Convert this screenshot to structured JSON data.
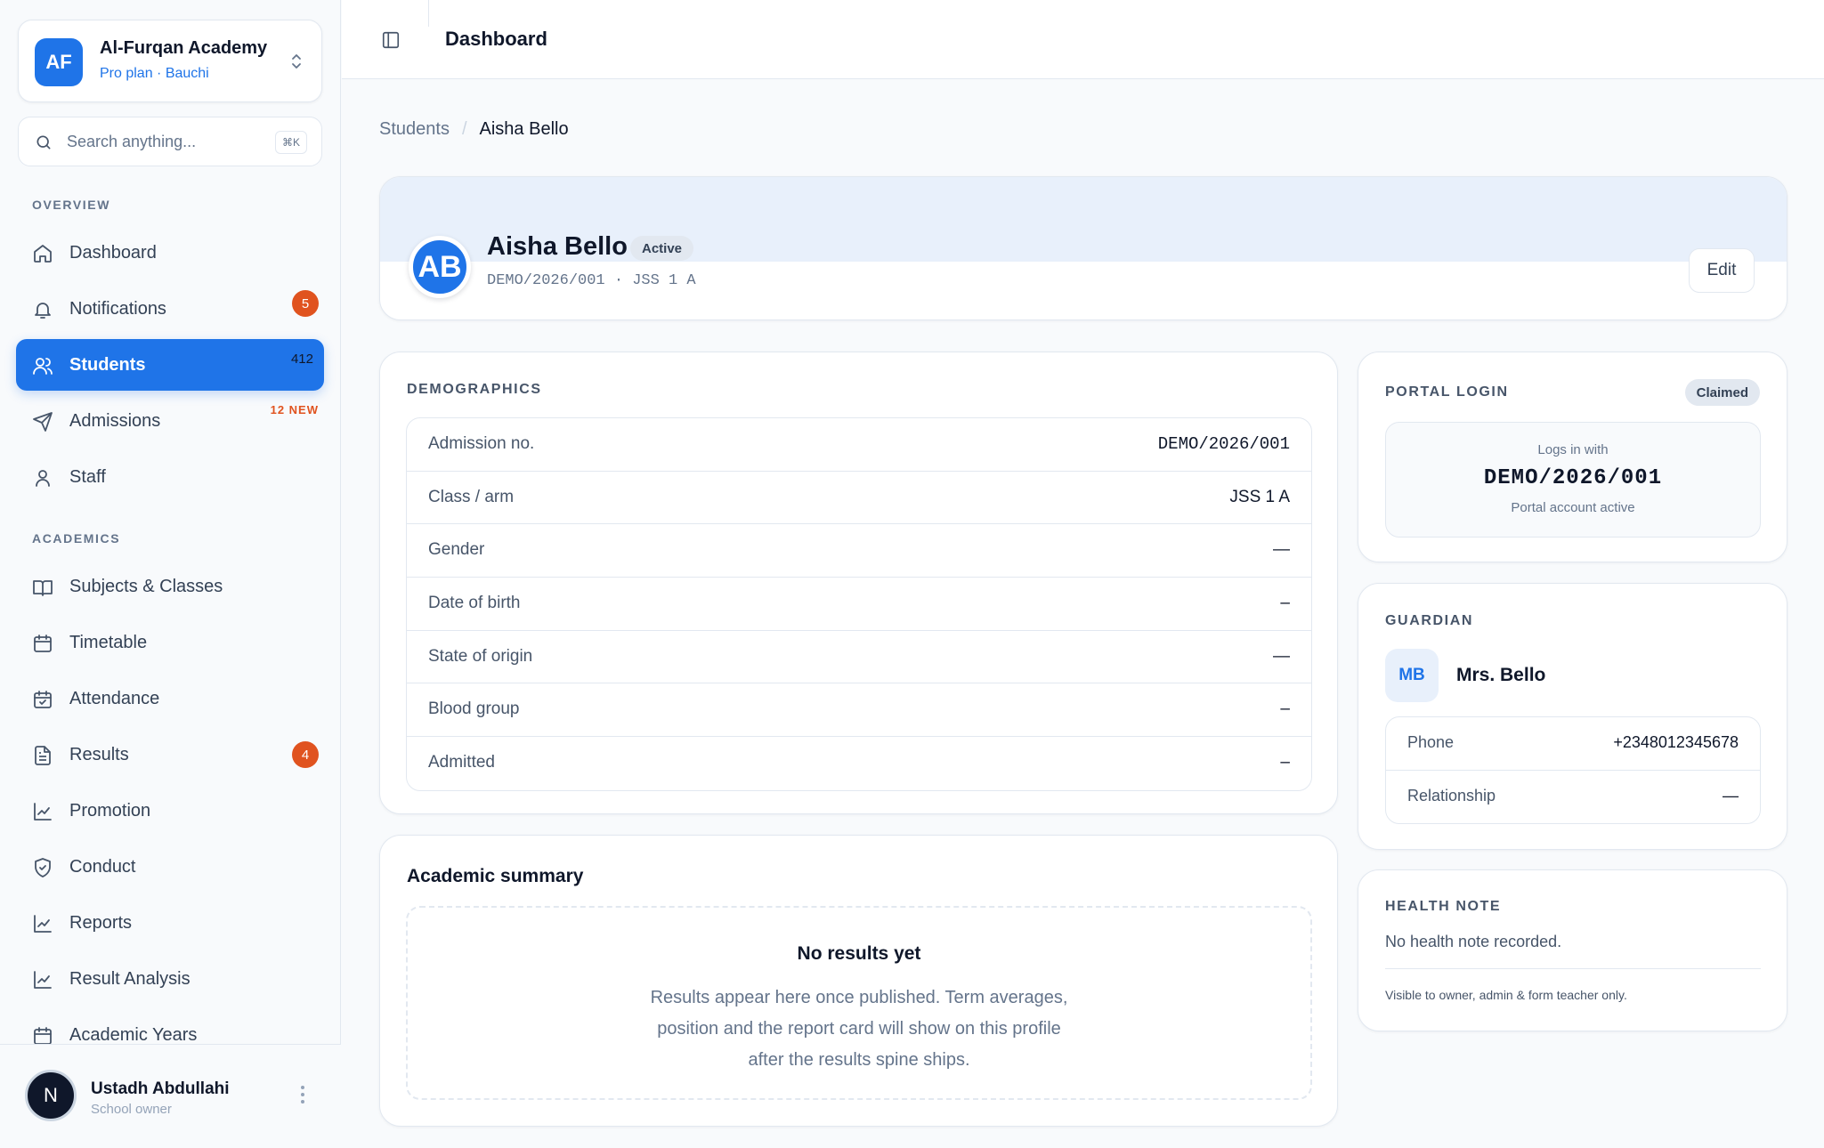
{
  "org": {
    "initials": "AF",
    "name": "Al-Furqan Academy",
    "plan": "Pro plan · Bauchi"
  },
  "search": {
    "placeholder": "Search anything...",
    "shortcut": "⌘K"
  },
  "sidebar": {
    "overview_label": "OVERVIEW",
    "academics_label": "ACADEMICS",
    "overview": [
      {
        "label": "Dashboard",
        "icon": "home-icon"
      },
      {
        "label": "Notifications",
        "icon": "bell-icon",
        "badge": "5"
      },
      {
        "label": "Students",
        "icon": "users-icon",
        "count": "412",
        "active": true
      },
      {
        "label": "Admissions",
        "icon": "send-icon",
        "tag": "12 NEW"
      },
      {
        "label": "Staff",
        "icon": "user-icon"
      }
    ],
    "academics": [
      {
        "label": "Subjects & Classes",
        "icon": "book-icon"
      },
      {
        "label": "Timetable",
        "icon": "calendar-icon"
      },
      {
        "label": "Attendance",
        "icon": "calendar-check-icon"
      },
      {
        "label": "Results",
        "icon": "file-text-icon",
        "badge": "4"
      },
      {
        "label": "Promotion",
        "icon": "line-chart-icon"
      },
      {
        "label": "Conduct",
        "icon": "shield-check-icon"
      },
      {
        "label": "Reports",
        "icon": "line-chart-icon"
      },
      {
        "label": "Result Analysis",
        "icon": "line-chart-icon"
      },
      {
        "label": "Academic Years",
        "icon": "calendar-icon"
      }
    ]
  },
  "user": {
    "initial": "N",
    "name": "Ustadh Abdullahi",
    "role": "School owner"
  },
  "topbar": {
    "title": "Dashboard"
  },
  "breadcrumb": {
    "parent": "Students",
    "separator": "/",
    "current": "Aisha Bello"
  },
  "profile": {
    "initials": "AB",
    "name": "Aisha Bello",
    "status": "Active",
    "meta": "DEMO/2026/001 · JSS 1 A",
    "edit_label": "Edit"
  },
  "demographics": {
    "label": "DEMOGRAPHICS",
    "rows": [
      {
        "key": "Admission no.",
        "value": "DEMO/2026/001"
      },
      {
        "key": "Class / arm",
        "value": "JSS 1 A"
      },
      {
        "key": "Gender",
        "value": "—"
      },
      {
        "key": "Date of birth",
        "value": "–"
      },
      {
        "key": "State of origin",
        "value": "—"
      },
      {
        "key": "Blood group",
        "value": "–"
      },
      {
        "key": "Admitted",
        "value": "–"
      }
    ]
  },
  "academic_summary": {
    "title": "Academic summary",
    "empty_title": "No results yet",
    "empty_desc": "Results appear here once published. Term averages, position and the report card will show on this profile after the results spine ships."
  },
  "portal": {
    "label": "PORTAL LOGIN",
    "status": "Claimed",
    "logs_in_with": "Logs in with",
    "login_id": "DEMO/2026/001",
    "account_status": "Portal account active"
  },
  "guardian": {
    "label": "GUARDIAN",
    "initials": "MB",
    "name": "Mrs. Bello",
    "rows": [
      {
        "key": "Phone",
        "value": "+2348012345678"
      },
      {
        "key": "Relationship",
        "value": "—"
      }
    ]
  },
  "health": {
    "label": "HEALTH NOTE",
    "note": "No health note recorded.",
    "visibility": "Visible to owner, admin & form teacher only."
  },
  "colors": {
    "accent": "#1f74e8",
    "badge": "#e0531f",
    "text": "#0f172a",
    "muted": "#64748b"
  }
}
